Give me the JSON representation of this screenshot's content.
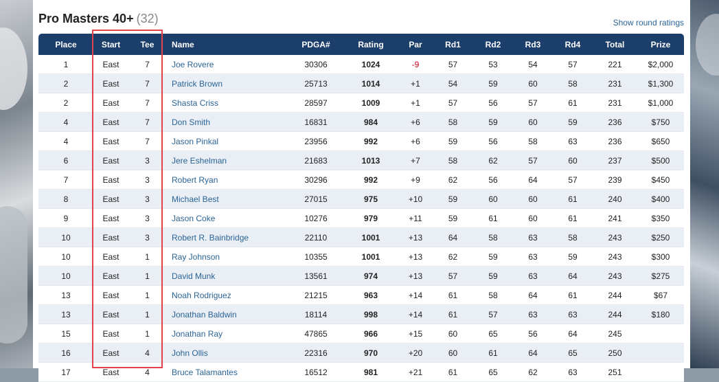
{
  "division": {
    "title": "Pro Masters 40+",
    "count": "(32)"
  },
  "show_ratings_link": "Show round ratings",
  "columns": [
    "Place",
    "Start",
    "Tee",
    "Name",
    "PDGA#",
    "Rating",
    "Par",
    "Rd1",
    "Rd2",
    "Rd3",
    "Rd4",
    "Total",
    "Prize"
  ],
  "rows": [
    {
      "place": "1",
      "start": "East",
      "tee": "7",
      "name": "Joe Rovere",
      "pdga": "30306",
      "rating": "1024",
      "par": "-9",
      "rd1": "57",
      "rd2": "53",
      "rd3": "54",
      "rd4": "57",
      "total": "221",
      "prize": "$2,000"
    },
    {
      "place": "2",
      "start": "East",
      "tee": "7",
      "name": "Patrick Brown",
      "pdga": "25713",
      "rating": "1014",
      "par": "+1",
      "rd1": "54",
      "rd2": "59",
      "rd3": "60",
      "rd4": "58",
      "total": "231",
      "prize": "$1,300"
    },
    {
      "place": "2",
      "start": "East",
      "tee": "7",
      "name": "Shasta Criss",
      "pdga": "28597",
      "rating": "1009",
      "par": "+1",
      "rd1": "57",
      "rd2": "56",
      "rd3": "57",
      "rd4": "61",
      "total": "231",
      "prize": "$1,000"
    },
    {
      "place": "4",
      "start": "East",
      "tee": "7",
      "name": "Don Smith",
      "pdga": "16831",
      "rating": "984",
      "par": "+6",
      "rd1": "58",
      "rd2": "59",
      "rd3": "60",
      "rd4": "59",
      "total": "236",
      "prize": "$750"
    },
    {
      "place": "4",
      "start": "East",
      "tee": "7",
      "name": "Jason Pinkal",
      "pdga": "23956",
      "rating": "992",
      "par": "+6",
      "rd1": "59",
      "rd2": "56",
      "rd3": "58",
      "rd4": "63",
      "total": "236",
      "prize": "$650"
    },
    {
      "place": "6",
      "start": "East",
      "tee": "3",
      "name": "Jere Eshelman",
      "pdga": "21683",
      "rating": "1013",
      "par": "+7",
      "rd1": "58",
      "rd2": "62",
      "rd3": "57",
      "rd4": "60",
      "total": "237",
      "prize": "$500"
    },
    {
      "place": "7",
      "start": "East",
      "tee": "3",
      "name": "Robert Ryan",
      "pdga": "30296",
      "rating": "992",
      "par": "+9",
      "rd1": "62",
      "rd2": "56",
      "rd3": "64",
      "rd4": "57",
      "total": "239",
      "prize": "$450"
    },
    {
      "place": "8",
      "start": "East",
      "tee": "3",
      "name": "Michael Best",
      "pdga": "27015",
      "rating": "975",
      "par": "+10",
      "rd1": "59",
      "rd2": "60",
      "rd3": "60",
      "rd4": "61",
      "total": "240",
      "prize": "$400"
    },
    {
      "place": "9",
      "start": "East",
      "tee": "3",
      "name": "Jason Coke",
      "pdga": "10276",
      "rating": "979",
      "par": "+11",
      "rd1": "59",
      "rd2": "61",
      "rd3": "60",
      "rd4": "61",
      "total": "241",
      "prize": "$350"
    },
    {
      "place": "10",
      "start": "East",
      "tee": "3",
      "name": "Robert R. Bainbridge",
      "pdga": "22110",
      "rating": "1001",
      "par": "+13",
      "rd1": "64",
      "rd2": "58",
      "rd3": "63",
      "rd4": "58",
      "total": "243",
      "prize": "$250"
    },
    {
      "place": "10",
      "start": "East",
      "tee": "1",
      "name": "Ray Johnson",
      "pdga": "10355",
      "rating": "1001",
      "par": "+13",
      "rd1": "62",
      "rd2": "59",
      "rd3": "63",
      "rd4": "59",
      "total": "243",
      "prize": "$300"
    },
    {
      "place": "10",
      "start": "East",
      "tee": "1",
      "name": "David Munk",
      "pdga": "13561",
      "rating": "974",
      "par": "+13",
      "rd1": "57",
      "rd2": "59",
      "rd3": "63",
      "rd4": "64",
      "total": "243",
      "prize": "$275"
    },
    {
      "place": "13",
      "start": "East",
      "tee": "1",
      "name": "Noah Rodriguez",
      "pdga": "21215",
      "rating": "963",
      "par": "+14",
      "rd1": "61",
      "rd2": "58",
      "rd3": "64",
      "rd4": "61",
      "total": "244",
      "prize": "$67"
    },
    {
      "place": "13",
      "start": "East",
      "tee": "1",
      "name": "Jonathan Baldwin",
      "pdga": "18114",
      "rating": "998",
      "par": "+14",
      "rd1": "61",
      "rd2": "57",
      "rd3": "63",
      "rd4": "63",
      "total": "244",
      "prize": "$180"
    },
    {
      "place": "15",
      "start": "East",
      "tee": "1",
      "name": "Jonathan Ray",
      "pdga": "47865",
      "rating": "966",
      "par": "+15",
      "rd1": "60",
      "rd2": "65",
      "rd3": "56",
      "rd4": "64",
      "total": "245",
      "prize": ""
    },
    {
      "place": "16",
      "start": "East",
      "tee": "4",
      "name": "John Ollis",
      "pdga": "22316",
      "rating": "970",
      "par": "+20",
      "rd1": "60",
      "rd2": "61",
      "rd3": "64",
      "rd4": "65",
      "total": "250",
      "prize": ""
    },
    {
      "place": "17",
      "start": "East",
      "tee": "4",
      "name": "Bruce Talamantes",
      "pdga": "16512",
      "rating": "981",
      "par": "+21",
      "rd1": "61",
      "rd2": "65",
      "rd3": "62",
      "rd4": "63",
      "total": "251",
      "prize": ""
    }
  ],
  "colors": {
    "header_bg": "#1c3e6a",
    "link": "#2a6496",
    "negative_par": "#d0021b",
    "highlight_box": "#e2414a",
    "row_alt": "#eaeff6"
  }
}
